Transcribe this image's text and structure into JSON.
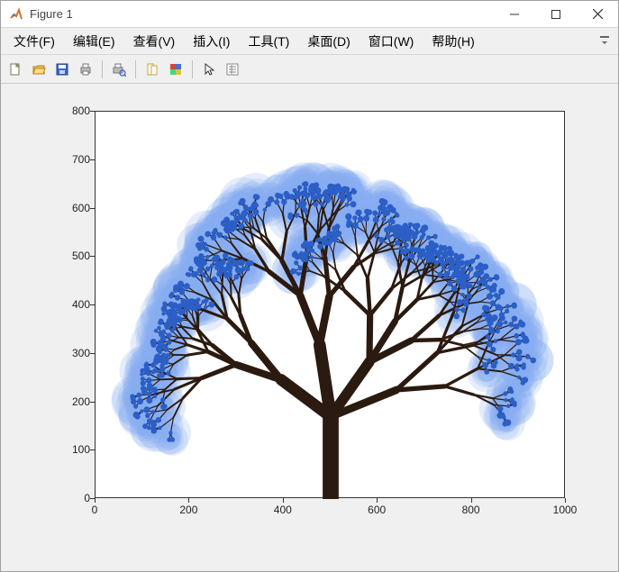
{
  "window": {
    "title": "Figure 1"
  },
  "menu": {
    "items": [
      "文件(F)",
      "编辑(E)",
      "查看(V)",
      "插入(I)",
      "工具(T)",
      "桌面(D)",
      "窗口(W)",
      "帮助(H)"
    ]
  },
  "toolbar": {
    "icons": [
      "new-file-icon",
      "open-folder-icon",
      "save-icon",
      "print-icon",
      "sep",
      "print-preview-icon",
      "sep",
      "link-icon",
      "colormap-icon",
      "sep",
      "cursor-icon",
      "inspector-icon"
    ]
  },
  "chart_data": {
    "type": "line",
    "title": "",
    "xlabel": "",
    "ylabel": "",
    "xlim": [
      0,
      1000
    ],
    "ylim": [
      0,
      800
    ],
    "xticks": [
      0,
      200,
      400,
      600,
      800,
      1000
    ],
    "yticks": [
      0,
      100,
      200,
      300,
      400,
      500,
      600,
      700,
      800
    ],
    "grid": false,
    "description": "Fractal tree drawing: brown recursive branches with blue glow leaf clusters",
    "tree": {
      "trunk_color": "#2b1a0f",
      "leaf_core": "#2b5fc7",
      "leaf_glow": "#88aef2",
      "root": [
        500,
        0
      ],
      "root_height": 170,
      "spread_x": [
        220,
        760
      ],
      "spread_y": [
        280,
        470
      ]
    }
  }
}
